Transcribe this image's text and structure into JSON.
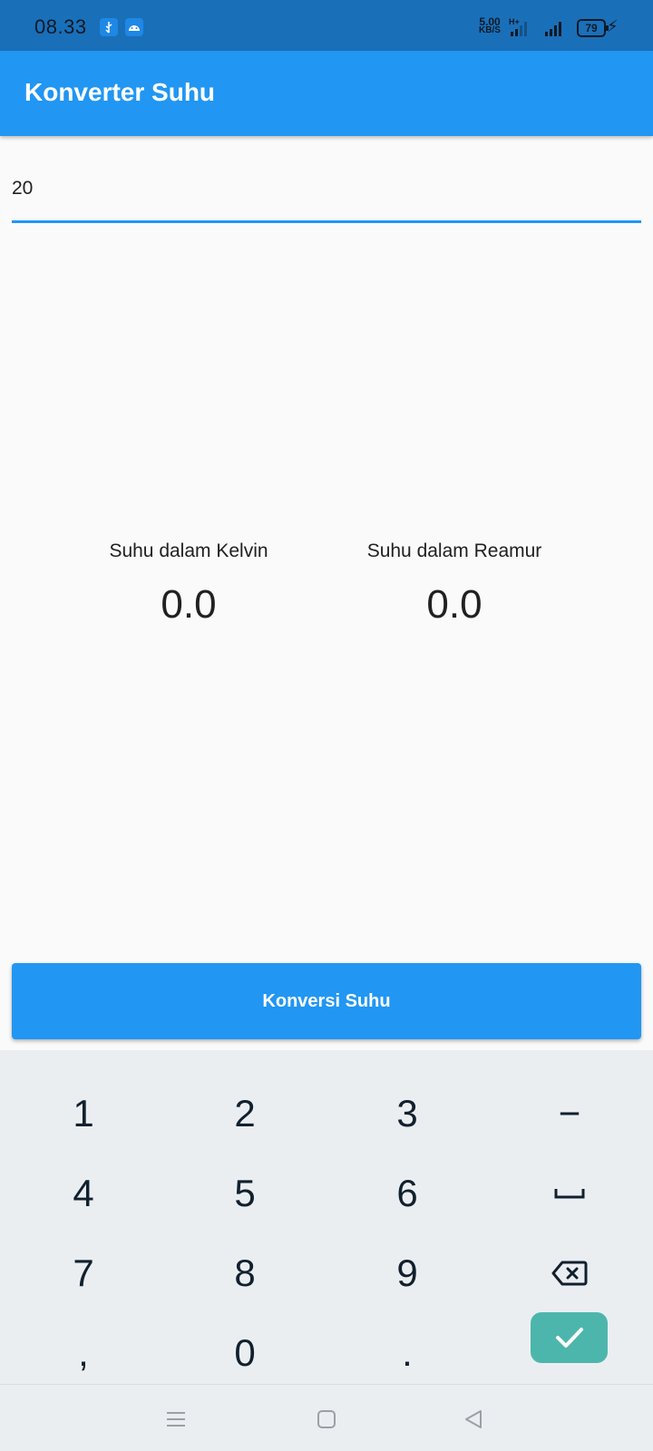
{
  "status_bar": {
    "time": "08.33",
    "net_speed_value": "5.00",
    "net_speed_unit": "KB/S",
    "network_type": "H+",
    "battery": "79",
    "usb_icon": "usb-icon",
    "android_icon": "android-icon"
  },
  "app_bar": {
    "title": "Konverter Suhu"
  },
  "input": {
    "value": "20"
  },
  "results": {
    "kelvin_label": "Suhu dalam Kelvin",
    "kelvin_value": "0.0",
    "reamur_label": "Suhu dalam Reamur",
    "reamur_value": "0.0"
  },
  "button": {
    "label": "Konversi Suhu"
  },
  "keyboard": {
    "keys": [
      "1",
      "2",
      "3",
      "−",
      "4",
      "5",
      "6",
      "space-icon",
      "7",
      "8",
      "9",
      "backspace-icon",
      ",",
      "0",
      ".",
      "check-icon"
    ]
  },
  "nav_bar": {
    "icons": [
      "menu-icon",
      "home-icon",
      "back-icon"
    ]
  },
  "colors": {
    "primary": "#2196F3",
    "status_bar": "#1A6FB9",
    "enter_key": "#4DB6AC",
    "keyboard_bg": "#EBEEF1",
    "page_bg": "#FAFAFA"
  }
}
